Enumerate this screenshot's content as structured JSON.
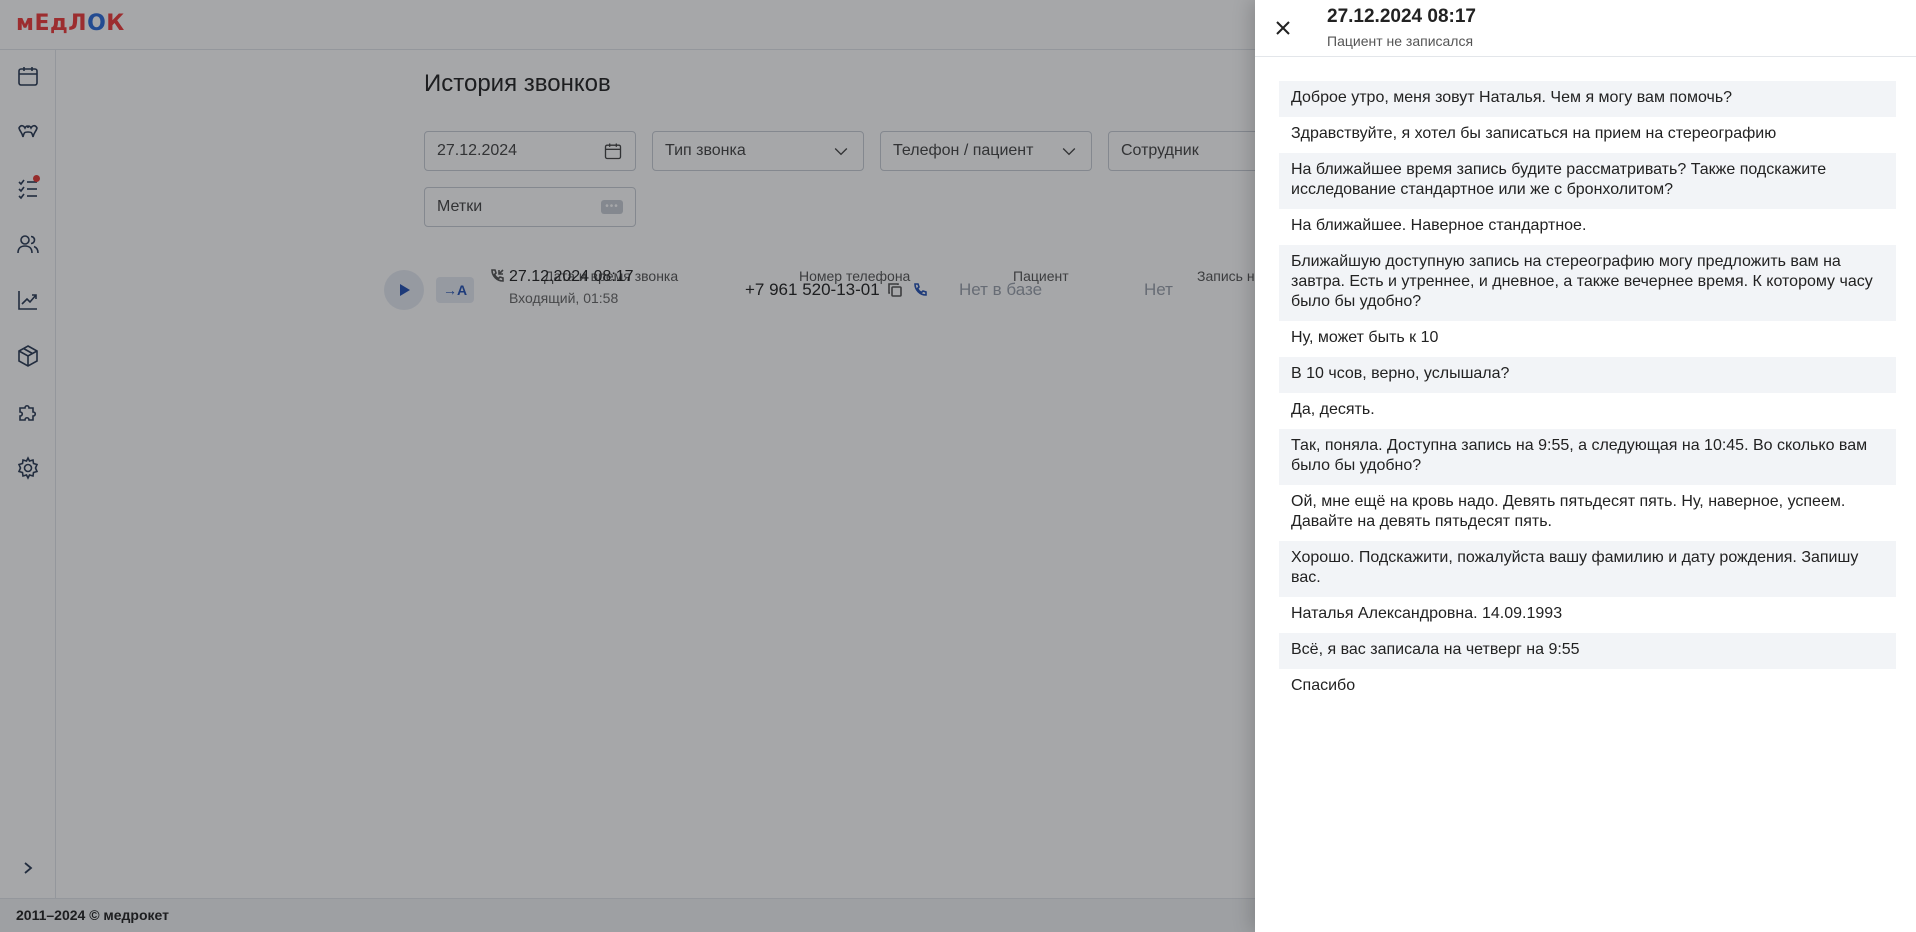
{
  "app": {
    "logo_text_1": "мЕдЛ",
    "logo_text_o": "О",
    "logo_text_2": "К",
    "footer": "2011–2024 © медрокет"
  },
  "sidebar": {
    "items": [
      {
        "icon": "calendar-icon"
      },
      {
        "icon": "tooth-icon"
      },
      {
        "icon": "task-list-icon",
        "has_notification": true
      },
      {
        "icon": "users-icon"
      },
      {
        "icon": "chart-icon"
      },
      {
        "icon": "box-icon"
      },
      {
        "icon": "puzzle-icon"
      },
      {
        "icon": "gear-icon"
      }
    ]
  },
  "page": {
    "title": "История звонков",
    "filters": {
      "date": "27.12.2024",
      "call_type": "Тип звонка",
      "phone_patient": "Телефон / пациент",
      "employee": "Сотрудник",
      "tags": "Метки"
    },
    "table": {
      "headers": [
        "Дата и время звонка",
        "Номер телефона",
        "Пациент",
        "Запись н"
      ],
      "rows": [
        {
          "ai_badge": "→A",
          "datetime": "27.12.2024 08:17",
          "details": "Входящий, 01:58",
          "phone": "+7 961 520-13-01",
          "patient": "Нет в базе",
          "appointment": "Нет"
        }
      ]
    }
  },
  "drawer": {
    "title": "27.12.2024 08:17",
    "subtitle": "Пациент не записался",
    "messages": [
      "Доброе утро, меня зовут Наталья. Чем я могу вам помочь?",
      "Здравствуйте, я хотел бы записаться на прием на стереографию",
      "На ближайшее время запись будите рассматривать? Также подскажите исследование стандартное или же с бронхолитом?",
      "На ближайшее. Наверное стандартное.",
      "Ближайшую доступную запись на стереографию могу предложить вам на завтра. Есть и утреннее, и дневное, а также вечернее время. К которому часу было бы удобно?",
      "Ну, может быть к 10",
      "В 10 чсов, верно, услышала?",
      "Да, десять.",
      "Так, поняла. Доступна запись на 9:55, а следующая на 10:45. Во сколько вам было бы удобно?",
      "Ой, мне ещё на кровь надо. Девять пятьдесят пять. Ну, наверное, успеем. Давайте на девять пятьдесят пять.",
      "Хорошо. Подскажити, пожалуйста вашу фамилию и дату рождения. Запишу вас.",
      "Наталья Александровна. 14.09.1993",
      "Всё, я вас записала на четверг на 9:55",
      "Спасибо"
    ]
  },
  "colors": {
    "accent": "#2452b3",
    "logo_red": "#ef3b3b",
    "logo_blue": "#2d6bd9",
    "notification": "#e53935",
    "shaded_row": "#f2f4f7"
  }
}
